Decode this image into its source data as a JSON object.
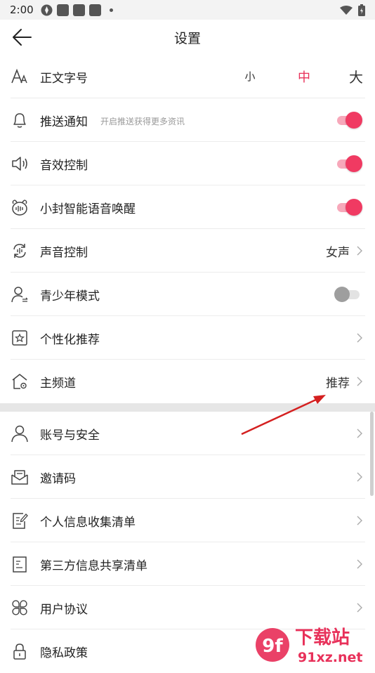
{
  "status_bar": {
    "time": "2:00"
  },
  "header": {
    "title": "设置"
  },
  "font_size": {
    "label": "正文字号",
    "options": [
      "小",
      "中",
      "大"
    ],
    "selected": "中"
  },
  "rows": {
    "push": {
      "label": "推送通知",
      "hint": "开启推送获得更多资讯",
      "on": true
    },
    "sound_effect": {
      "label": "音效控制",
      "on": true
    },
    "voice_wake": {
      "label": "小封智能语音唤醒",
      "on": true
    },
    "voice_control": {
      "label": "声音控制",
      "value": "女声"
    },
    "youth_mode": {
      "label": "青少年模式",
      "on": false
    },
    "personalized": {
      "label": "个性化推荐"
    },
    "main_channel": {
      "label": "主频道",
      "value": "推荐"
    },
    "account": {
      "label": "账号与安全"
    },
    "invite": {
      "label": "邀请码"
    },
    "personal_info": {
      "label": "个人信息收集清单"
    },
    "third_party": {
      "label": "第三方信息共享清单"
    },
    "user_agreement": {
      "label": "用户协议"
    },
    "privacy": {
      "label": "隐私政策"
    }
  },
  "colors": {
    "accent": "#e8315a",
    "toggle_on": "#f03a62",
    "annotation_arrow": "#d42020"
  },
  "watermark": {
    "logo": "9f",
    "text_top": "下载站",
    "text_bottom": "91xz.net"
  }
}
